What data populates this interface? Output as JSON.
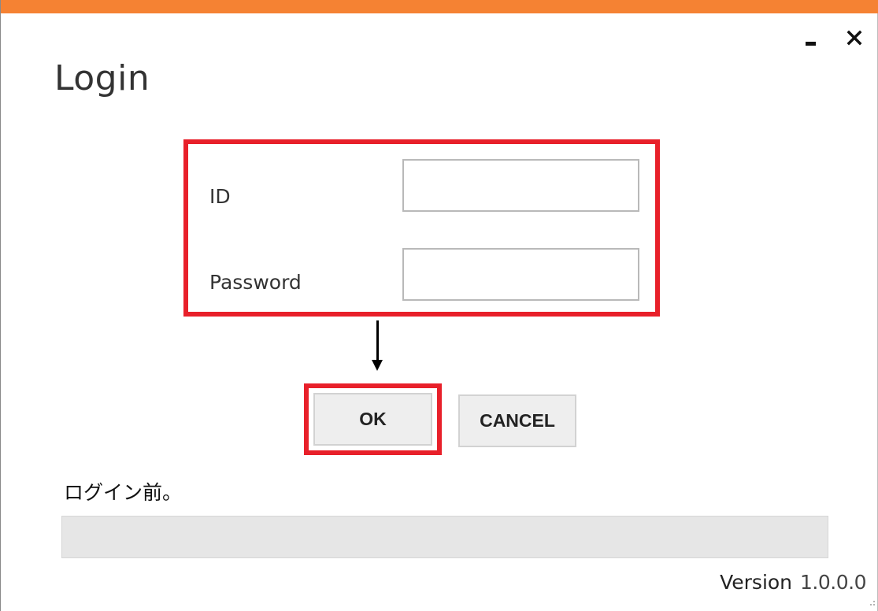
{
  "window": {
    "title": "Login",
    "accent_color": "#f58233",
    "close_glyph": "✕",
    "minimize_icon": "minimize-icon",
    "close_icon": "close-icon"
  },
  "form": {
    "id_label": "ID",
    "id_value": "",
    "password_label": "Password",
    "password_value": "",
    "highlight_color": "#e8202a"
  },
  "buttons": {
    "ok_label": "OK",
    "cancel_label": "CANCEL"
  },
  "annotation": {
    "arrow_icon": "arrow-down-icon"
  },
  "status": {
    "text": "ログイン前。",
    "progress": 0
  },
  "footer": {
    "version_label": "Version",
    "version_number": "1.0.0.0"
  }
}
